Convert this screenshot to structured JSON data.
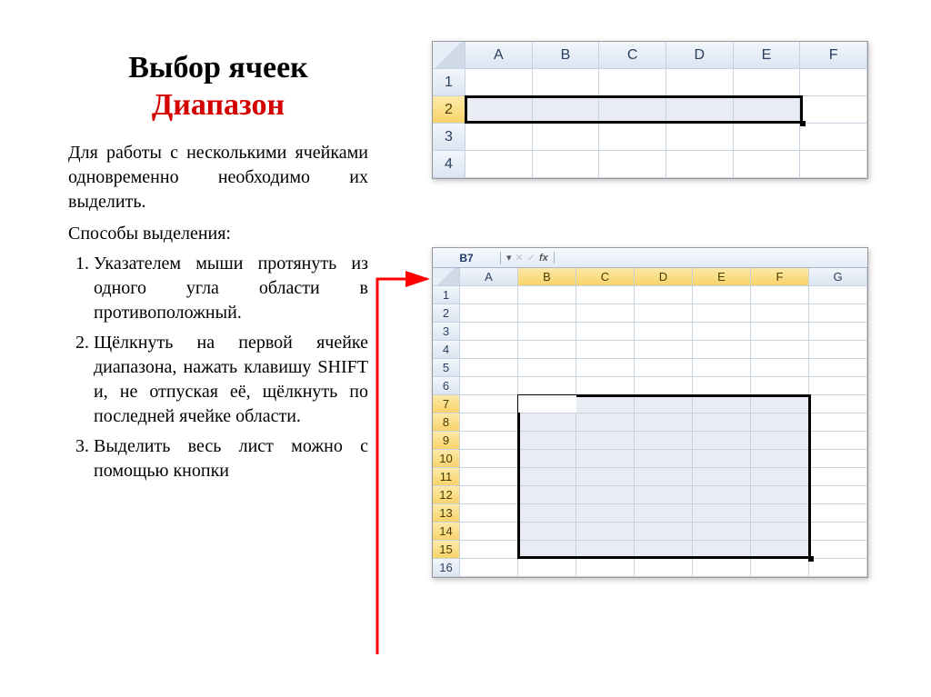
{
  "title_line1": "Выбор ячеек",
  "title_line2": "Диапазон",
  "intro": "Для работы с несколькими ячейками одновременно необходимо их выделить.",
  "subtitle": "Способы выделения:",
  "items": [
    "Указателем мыши протянуть из одного угла области в противоположный.",
    "Щёлкнуть на первой ячейке диапазона, нажать клавишу SHIFT и, не отпуская её, щёлкнуть по последней ячейке области.",
    "Выделить весь лист можно с помощью кнопки"
  ],
  "excel1": {
    "cols": [
      "A",
      "B",
      "C",
      "D",
      "E",
      "F"
    ],
    "rows": [
      "1",
      "2",
      "3",
      "4"
    ]
  },
  "excel2": {
    "name_box": "B7",
    "fx": "fx",
    "cols": [
      "A",
      "B",
      "C",
      "D",
      "E",
      "F",
      "G"
    ],
    "rows": [
      "1",
      "2",
      "3",
      "4",
      "5",
      "6",
      "7",
      "8",
      "9",
      "10",
      "11",
      "12",
      "13",
      "14",
      "15",
      "16"
    ]
  }
}
